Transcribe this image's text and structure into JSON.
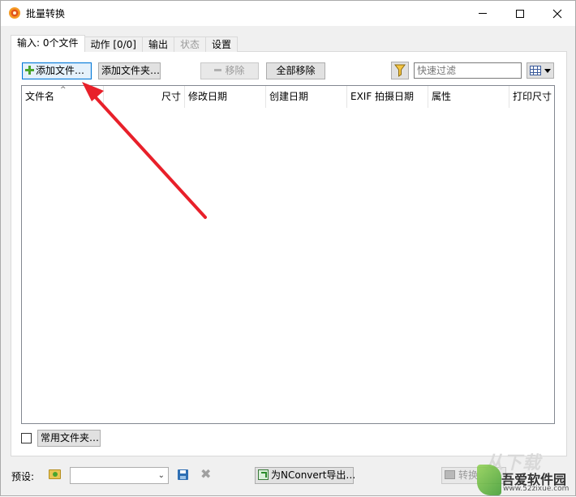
{
  "window": {
    "title": "批量转换"
  },
  "tabs": [
    {
      "label": "输入: 0个文件",
      "active": true,
      "enabled": true
    },
    {
      "label": "动作 [0/0]",
      "active": false,
      "enabled": true
    },
    {
      "label": "输出",
      "active": false,
      "enabled": true
    },
    {
      "label": "状态",
      "active": false,
      "enabled": false
    },
    {
      "label": "设置",
      "active": false,
      "enabled": true
    }
  ],
  "toolbar": {
    "add_files": "添加文件…",
    "add_folder": "添加文件夹…",
    "remove": "移除",
    "remove_all": "全部移除",
    "filter_placeholder": "快速过滤"
  },
  "file_list": {
    "columns": [
      "文件名",
      "尺寸",
      "修改日期",
      "创建日期",
      "EXIF 拍摄日期",
      "属性",
      "打印尺寸"
    ],
    "sort_indicator": "^",
    "rows": []
  },
  "bottom": {
    "common_folders": "常用文件夹…",
    "preset_label": "预设:",
    "preset_value": "",
    "export_nconvert": "为NConvert导出…",
    "convert": "转换"
  },
  "watermark": {
    "top": "从下载",
    "name": "吾爱软件园",
    "url": "www.52zixue.com"
  },
  "colors": {
    "accent": "#0078d7",
    "annotation_arrow": "#e8202a"
  }
}
